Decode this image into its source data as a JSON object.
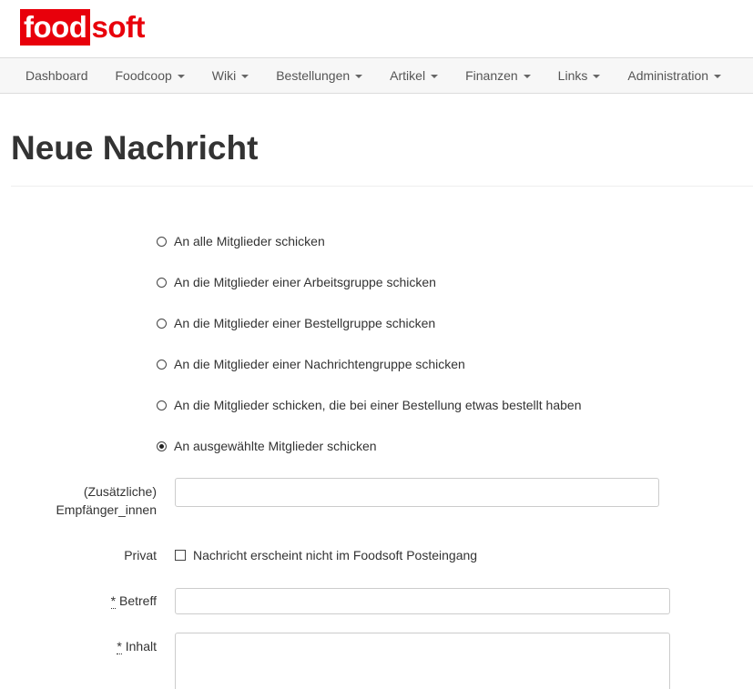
{
  "logo": {
    "part1": "food",
    "part2": "soft"
  },
  "nav": {
    "items": [
      {
        "label": "Dashboard",
        "dropdown": false
      },
      {
        "label": "Foodcoop",
        "dropdown": true
      },
      {
        "label": "Wiki",
        "dropdown": true
      },
      {
        "label": "Bestellungen",
        "dropdown": true
      },
      {
        "label": "Artikel",
        "dropdown": true
      },
      {
        "label": "Finanzen",
        "dropdown": true
      },
      {
        "label": "Links",
        "dropdown": true
      },
      {
        "label": "Administration",
        "dropdown": true
      }
    ]
  },
  "page": {
    "title": "Neue Nachricht"
  },
  "recipients": {
    "options": [
      {
        "label": "An alle Mitglieder schicken",
        "checked": false
      },
      {
        "label": "An die Mitglieder einer Arbeitsgruppe schicken",
        "checked": false
      },
      {
        "label": "An die Mitglieder einer Bestellgruppe schicken",
        "checked": false
      },
      {
        "label": "An die Mitglieder einer Nachrichtengruppe schicken",
        "checked": false
      },
      {
        "label": "An die Mitglieder schicken, die bei einer Bestellung etwas bestellt haben",
        "checked": false
      },
      {
        "label": "An ausgewählte Mitglieder schicken",
        "checked": true
      }
    ]
  },
  "form": {
    "additional_recipients_label": "(Zusätzliche) Empfänger_innen",
    "additional_recipients_value": "",
    "private_label": "Privat",
    "private_checkbox_label": "Nachricht erscheint nicht im Foodsoft Posteingang",
    "private_checked": false,
    "required_marker": "*",
    "subject_label": "Betreff",
    "subject_value": "",
    "body_label": "Inhalt",
    "body_value": ""
  },
  "colors": {
    "brand": "#e8000b",
    "navbar_bg": "#f7f7f7"
  }
}
